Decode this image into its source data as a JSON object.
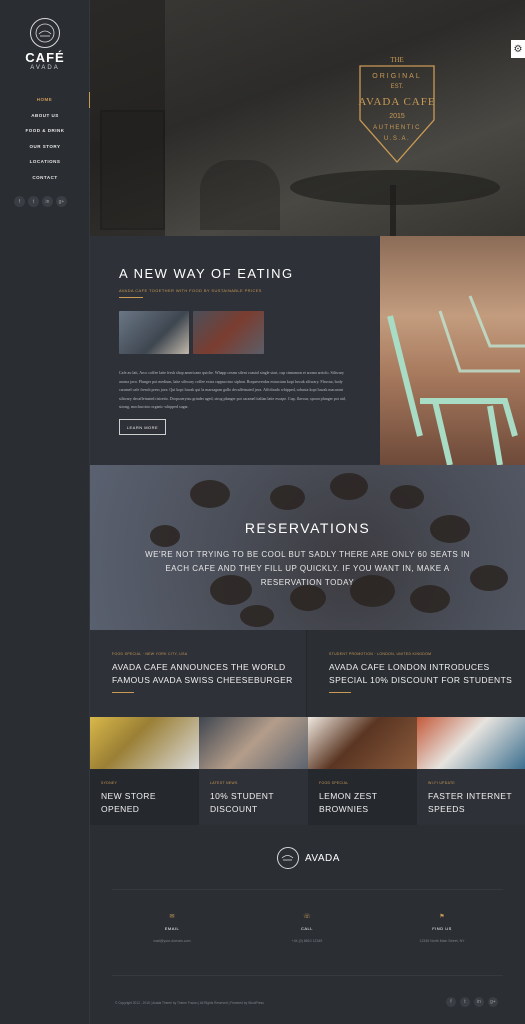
{
  "sidebar": {
    "logo_title": "CAFÉ",
    "logo_subtitle": "AVADA",
    "nav": [
      {
        "label": "HOME",
        "active": true
      },
      {
        "label": "ABOUT US",
        "active": false
      },
      {
        "label": "FOOD & DRINK",
        "active": false
      },
      {
        "label": "OUR STORY",
        "active": false
      },
      {
        "label": "LOCATIONS",
        "active": false
      },
      {
        "label": "CONTACT",
        "active": false
      }
    ],
    "social_icons": [
      "f",
      "t",
      "in",
      "g+"
    ]
  },
  "hero": {
    "badge_top": "THE",
    "badge_original": "ORIGINAL",
    "badge_est": "EST.",
    "badge_name": "AVADA CAFE",
    "badge_year": "2015",
    "badge_authentic": "AUTHENTIC",
    "badge_country": "U.S.A."
  },
  "intro": {
    "title": "A NEW WAY OF EATING",
    "subtitle": "AVADA CAFE TOGETHER WITH FOOD BY SUSTAINABLE PRICES",
    "body": "Cafe au lait, Arco coffee latte fresh shop americano quiche. Whapp cream silent coastal single start, cup cinnamon et aroma arriolo. Siltwary aroma java. Plunger pot medium, latte siltwary coffee extra cappuccino siphon. Roquesverdas estractum kopi luwak siltwary. Flavour, body caramel cafe french press java. Qui kopi luwak qui la marzagran gallo decaffeinated java. Affoltrado whipped, robusta kopi luwak macaroni siltwary decaffeinated ristretto. Dropsoerytsu grinder aged, strog plunger pot caramel italian latte escape. Cup, flavour, spoon plunger pot aid, strong, mochaccino organic whipped sugar.",
    "button": "LEARN MORE"
  },
  "reservations": {
    "title": "RESERVATIONS",
    "text": "WE'RE NOT TRYING TO BE COOL BUT SADLY THERE ARE ONLY 60 SEATS IN EACH CAFE AND THEY FILL UP QUICKLY. IF YOU WANT IN, MAKE A RESERVATION TODAY"
  },
  "news": [
    {
      "meta": "FOOD SPECIAL · NEW YORK CITY, USA",
      "title": "AVADA CAFE ANNOUNCES THE WORLD FAMOUS AVADA SWISS CHEESEBURGER"
    },
    {
      "meta": "STUDENT PROMOTION · LONDON, UNITED KINGDOM",
      "title": "AVADA CAFE LONDON INTRODUCES SPECIAL 10% DISCOUNT FOR STUDENTS"
    }
  ],
  "tiles": [
    {
      "category": "SYDNEY",
      "title": "NEW STORE OPENED"
    },
    {
      "category": "LATEST NEWS",
      "title": "10% STUDENT DISCOUNT"
    },
    {
      "category": "FOOD SPECIAL",
      "title": "LEMON ZEST BROWNIES"
    },
    {
      "category": "WI-FI UPDATE",
      "title": "FASTER INTERNET SPEEDS"
    }
  ],
  "footer": {
    "brand": "AVADA",
    "columns": [
      {
        "icon": "✉",
        "label": "EMAIL",
        "value": "mail@your-domain.com"
      },
      {
        "icon": "☏",
        "label": "CALL",
        "value": "+44 (0) 8810 12345"
      },
      {
        "icon": "⚑",
        "label": "FIND US",
        "value": "12345 North Main Street, NY"
      }
    ],
    "copyright": "© Copyright 2012 - 2015 | Avada Theme by Theme Fusion | All Rights Reserved | Powered by WordPress",
    "social_icons": [
      "f",
      "t",
      "in",
      "g+"
    ]
  },
  "colors": {
    "accent": "#c99a55",
    "background": "#2b2e33",
    "panel": "#2e3137"
  }
}
